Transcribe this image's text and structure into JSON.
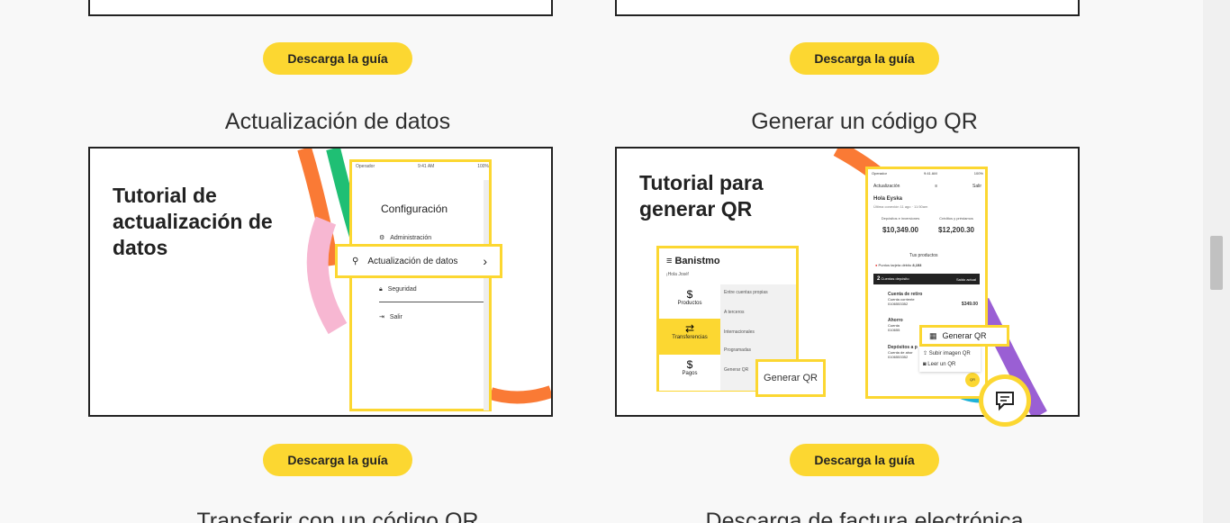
{
  "guides": [
    {
      "button_label": "Descarga la guía"
    },
    {
      "button_label": "Descarga la guía"
    }
  ],
  "cards": [
    {
      "heading": "Actualización de datos",
      "title_lines": [
        "Tutorial de",
        "actualización de",
        "datos"
      ],
      "phone": {
        "status_left": "Operador",
        "status_time": "9:41 AM",
        "status_right": "100%",
        "screen_title": "Configuración",
        "menu": [
          "Administración",
          "Actualización de datos",
          "Seguridad",
          "Salir"
        ]
      },
      "button_label": "Descarga la guía"
    },
    {
      "heading": "Generar un código QR",
      "title_lines": [
        "Tutorial para",
        "generar QR"
      ],
      "left_panel": {
        "brand": "Banistmo",
        "greeting": "¡Hola José!",
        "nav": [
          "Productos",
          "Transferencias",
          "Pagos"
        ],
        "submenu": [
          "Entre cuentas propias",
          "A terceros",
          "Internacionales",
          "Programadas",
          "Generar QR"
        ],
        "highlight_button": "Generar QR"
      },
      "phone": {
        "status_left": "Operador",
        "status_time": "9:41 AM",
        "status_right": "100%",
        "top_left": "Actualización",
        "top_right": "Salir",
        "greeting": "Hola Eyska",
        "last_login": "Última conexión 11 ago · 11:50am",
        "deposits_label": "Depósitos e inversiones",
        "deposits_value": "$10,349.00",
        "credits_label": "Créditos y préstamos",
        "credits_value": "$12,200.30",
        "products_label": "Tus productos",
        "points": "Puntos tarjeta débito",
        "points_value": "8,153",
        "section_count": "2",
        "section_label": "Cuentas depósito",
        "section_right": "Saldo actual",
        "account_name": "Cuenta de retiro",
        "account_type": "Cuenta corriente",
        "account_number": "0106553352",
        "account_balance": "$349.00",
        "row2_name": "Ahorro",
        "row2_type": "Cuenta",
        "row2_number": "010655",
        "row3_name": "Depósitos a p",
        "row3_type": "Cuenta de ahor",
        "row3_number": "0106553352",
        "popup_main": "Generar QR",
        "popup_opt1": "Subir imagen QR",
        "popup_opt2": "Leer un QR",
        "fab_label": "QR"
      },
      "button_label": "Descarga la guía"
    }
  ],
  "next_headings": [
    "Transferir con un código QR",
    "Descarga de factura electrónica"
  ]
}
